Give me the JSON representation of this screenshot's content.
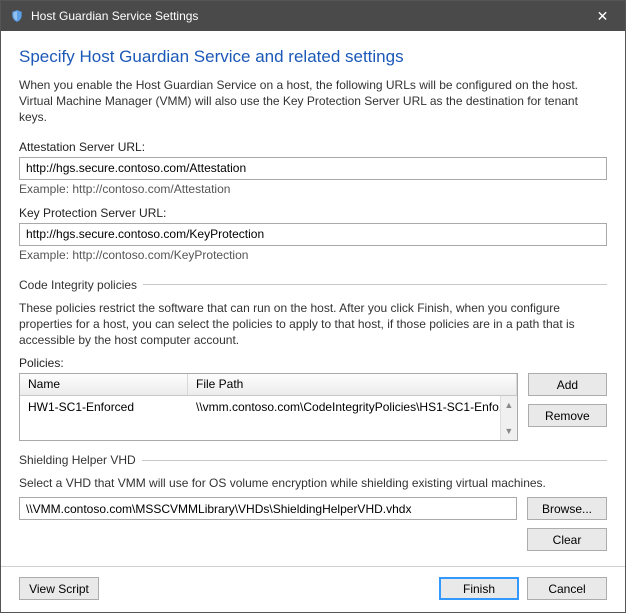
{
  "titlebar": {
    "title": "Host Guardian Service Settings",
    "close_glyph": "✕"
  },
  "heading": "Specify Host Guardian Service and related settings",
  "description": "When you enable the Host Guardian Service on a host, the following URLs will be configured on the host. Virtual Machine Manager (VMM) will also use the Key Protection Server URL as the destination for tenant keys.",
  "attestation": {
    "label": "Attestation Server URL:",
    "value": "http://hgs.secure.contoso.com/Attestation",
    "example": "Example: http://contoso.com/Attestation"
  },
  "keyprotection": {
    "label": "Key Protection Server URL:",
    "value": "http://hgs.secure.contoso.com/KeyProtection",
    "example": "Example: http://contoso.com/KeyProtection"
  },
  "code_integrity": {
    "section_title": "Code Integrity policies",
    "description": "These policies restrict the software that can run on the host. After you click Finish, when you configure properties for a host, you can select the policies to apply to that host, if those policies are in a path that is accessible by the host computer account.",
    "policies_label": "Policies:",
    "columns": {
      "name": "Name",
      "path": "File Path"
    },
    "rows": [
      {
        "name": "HW1-SC1-Enforced",
        "path": "\\\\vmm.contoso.com\\CodeIntegrityPolicies\\HS1-SC1-Enfo..."
      }
    ],
    "buttons": {
      "add": "Add",
      "remove": "Remove"
    }
  },
  "shielding": {
    "section_title": "Shielding Helper VHD",
    "description": "Select a VHD that VMM will use for OS volume encryption while shielding existing virtual machines.",
    "value": "\\\\VMM.contoso.com\\MSSCVMMLibrary\\VHDs\\ShieldingHelperVHD.vhdx",
    "buttons": {
      "browse": "Browse...",
      "clear": "Clear"
    }
  },
  "footer": {
    "view_script": "View Script",
    "finish": "Finish",
    "cancel": "Cancel"
  }
}
